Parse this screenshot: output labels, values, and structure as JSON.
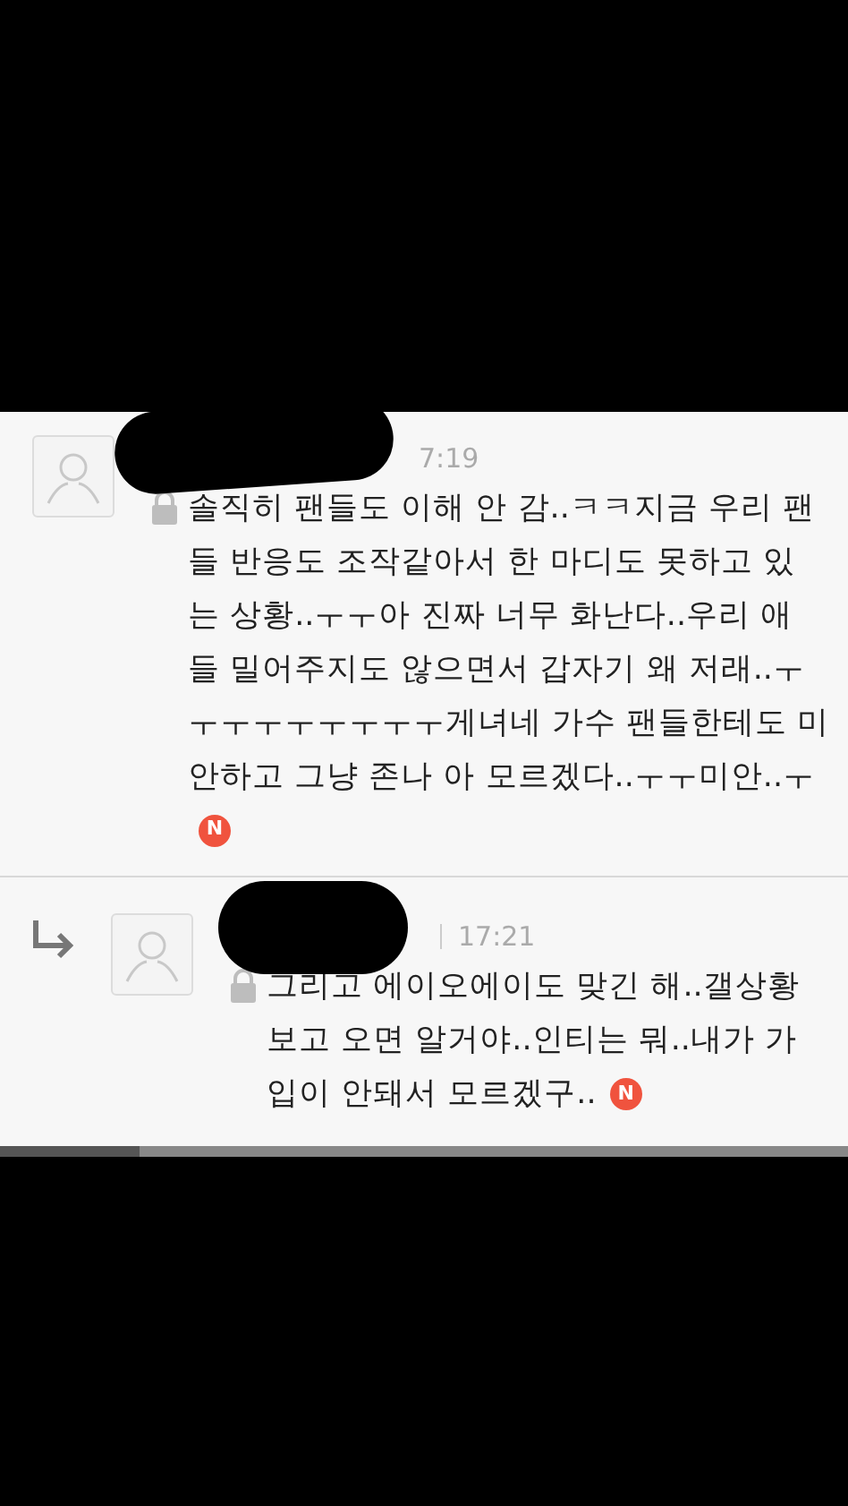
{
  "comments": [
    {
      "reply": false,
      "time": "7:19",
      "locked": true,
      "is_new": true,
      "badge": "N",
      "lines": [
        "솔직히 팬들도 이해 안 감..ㅋㅋ지금 우리 팬",
        "들 반응도 조작같아서 한 마디도 못하고 있",
        "는 상황..ㅜㅜ아 진짜 너무 화난다..우리 애",
        "들 밀어주지도 않으면서 갑자기 왜 저래..ㅜ",
        "ㅜㅜㅜㅜㅜㅜㅜㅜ게녀네 가수 팬들한테도 미",
        "안하고 그냥 존나 아 모르겠다..ㅜㅜ미안..ㅜ"
      ]
    },
    {
      "reply": true,
      "time": "17:21",
      "locked": true,
      "is_new": true,
      "badge": "N",
      "lines": [
        "그리고 에이오에이도 맞긴 해..갤상황",
        "보고 오면 알거야..인티는 뭐..내가 가",
        "입이 안돼서 모르겠구.."
      ]
    }
  ]
}
